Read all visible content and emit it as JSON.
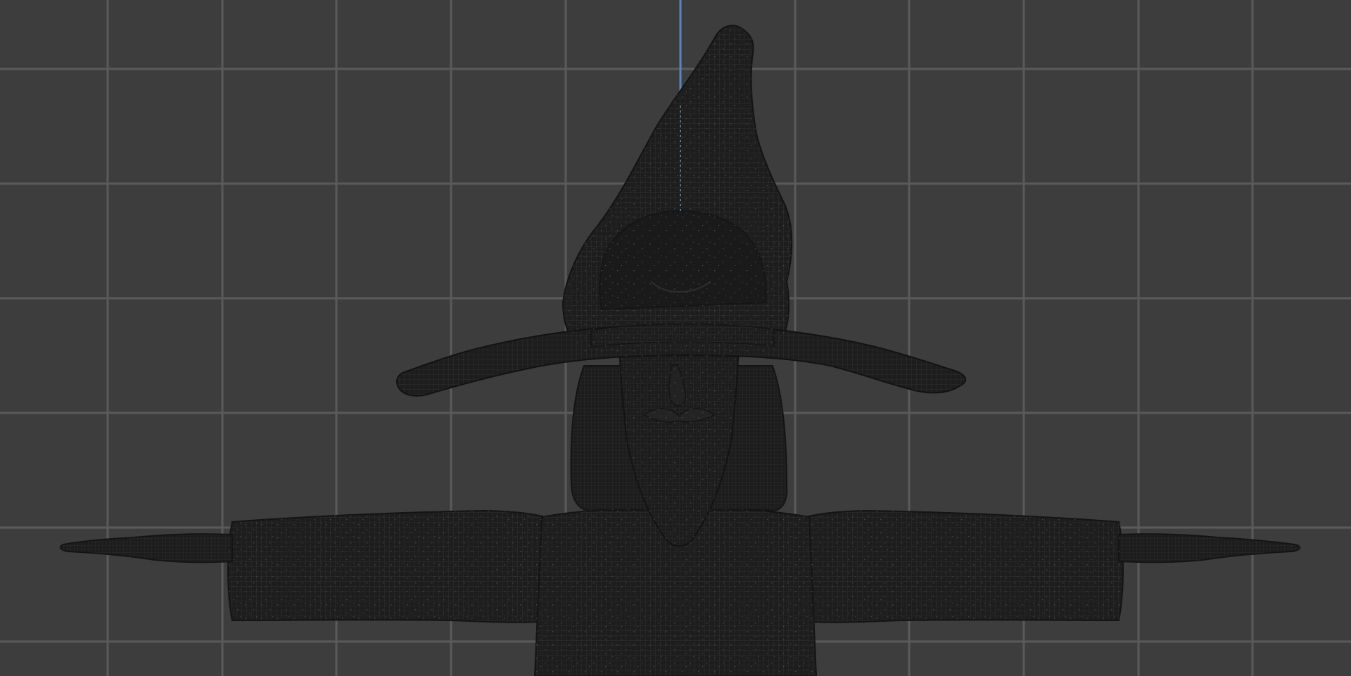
{
  "viewport": {
    "view": "front-orthographic",
    "display_mode": "wireframe-on-shaded",
    "grid": true,
    "background_color": "#3d3d3d",
    "grid_color": "#5c5c5c",
    "axis_color": "#5b86c4",
    "mesh_color": "#1b1b1b",
    "wire_color": "#2c2c2c"
  },
  "scene": {
    "object": "wizard-character-mesh",
    "pose": "T-pose",
    "parts": [
      "pointed-hat",
      "hat-brim",
      "face",
      "beard",
      "hair",
      "torso",
      "left-arm",
      "right-arm",
      "left-hand",
      "right-hand"
    ]
  }
}
